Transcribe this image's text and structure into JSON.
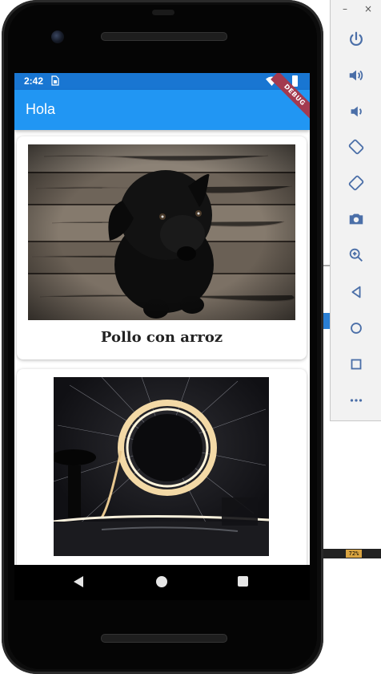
{
  "status_bar": {
    "time": "2:42"
  },
  "app_bar": {
    "title": "Hola",
    "debug_banner": "DEBUG"
  },
  "cards": [
    {
      "caption": "Pollo con arroz",
      "image": "black-puppy-on-wooden-floor"
    },
    {
      "caption": "",
      "image": "steel-wool-light-circle"
    }
  ],
  "emulator_toolbar": {
    "window_controls": [
      "–",
      "×"
    ],
    "buttons": [
      "power-icon",
      "volume-up-icon",
      "volume-down-icon",
      "rotate-left-icon",
      "rotate-right-icon",
      "camera-icon",
      "zoom-icon",
      "back-icon",
      "home-icon",
      "overview-icon",
      "more-icon"
    ]
  },
  "desktop": {
    "battery_label": "72%"
  },
  "colors": {
    "primary": "#2196f3",
    "status_bar": "#1976d2",
    "debug": "#a33a4f",
    "toolbar_icon": "#4b6fa8"
  }
}
